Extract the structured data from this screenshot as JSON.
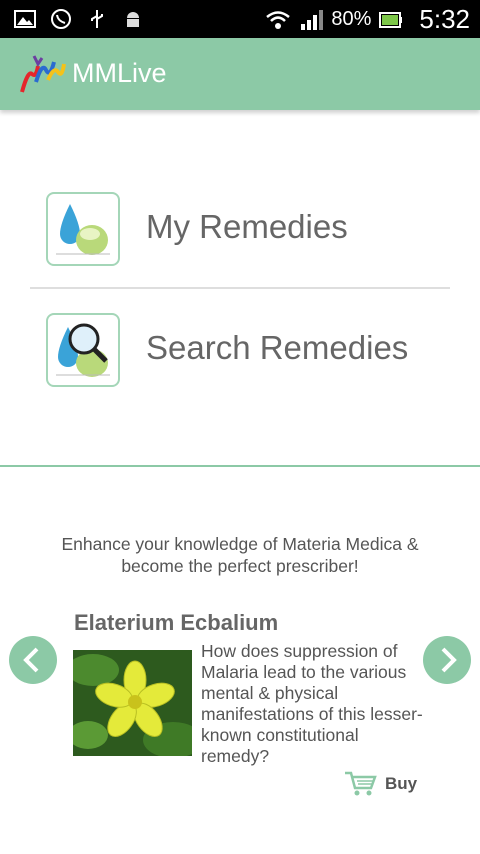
{
  "status_bar": {
    "icons_left": [
      "image-icon",
      "whatsapp-icon",
      "usb-icon",
      "android-icon"
    ],
    "icons_right": [
      "wifi-icon",
      "signal-icon"
    ],
    "battery": "80%",
    "time": "5:32"
  },
  "app_bar": {
    "title": "MMLive"
  },
  "menu": {
    "items": [
      {
        "label": "My Remedies",
        "icon": "remedies-icon"
      },
      {
        "label": "Search Remedies",
        "icon": "search-remedies-icon"
      }
    ]
  },
  "promo": {
    "tagline": "Enhance your knowledge of Materia Medica & become the perfect prescriber!",
    "remedy_name": "Elaterium Ecbalium",
    "description": "How does suppression of Malaria lead to the various mental & physical manifestations of this lesser-known constitutional remedy?",
    "buy_label": "Buy"
  },
  "colors": {
    "accent": "#8cc9a6",
    "status_bar": "#000000",
    "text": "#666666"
  }
}
